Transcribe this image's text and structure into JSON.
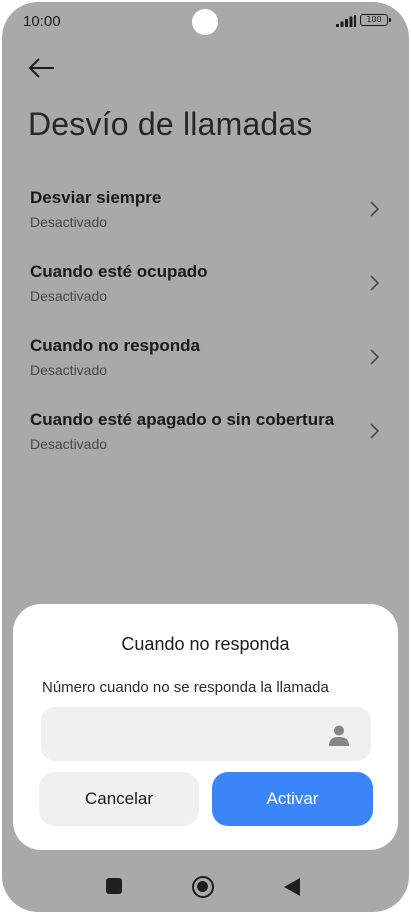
{
  "status_bar": {
    "time": "10:00",
    "battery": "100",
    "signal_icon": "signal-icon",
    "battery_icon": "battery-icon"
  },
  "header": {
    "back_icon": "arrow-left-icon",
    "title": "Desvío de llamadas"
  },
  "settings": {
    "items": [
      {
        "title": "Desviar siempre",
        "status": "Desactivado"
      },
      {
        "title": "Cuando esté ocupado",
        "status": "Desactivado"
      },
      {
        "title": "Cuando no responda",
        "status": "Desactivado"
      },
      {
        "title": "Cuando esté apagado o sin cobertura",
        "status": "Desactivado"
      }
    ],
    "chevron_icon": "chevron-right-icon"
  },
  "dialog": {
    "title": "Cuando no responda",
    "label": "Número cuando no se responda la llamada",
    "input_value": "",
    "input_placeholder": "",
    "contact_icon": "contact-person-icon",
    "cancel_label": "Cancelar",
    "activate_label": "Activar"
  },
  "colors": {
    "accent": "#3a86f8",
    "scrim": "#a9a9a9",
    "dialog_bg": "#ffffff",
    "field_bg": "#f0f0f0"
  },
  "nav_bar": {
    "recents_icon": "square-icon",
    "home_icon": "home-circle-icon",
    "back_icon": "triangle-back-icon"
  }
}
